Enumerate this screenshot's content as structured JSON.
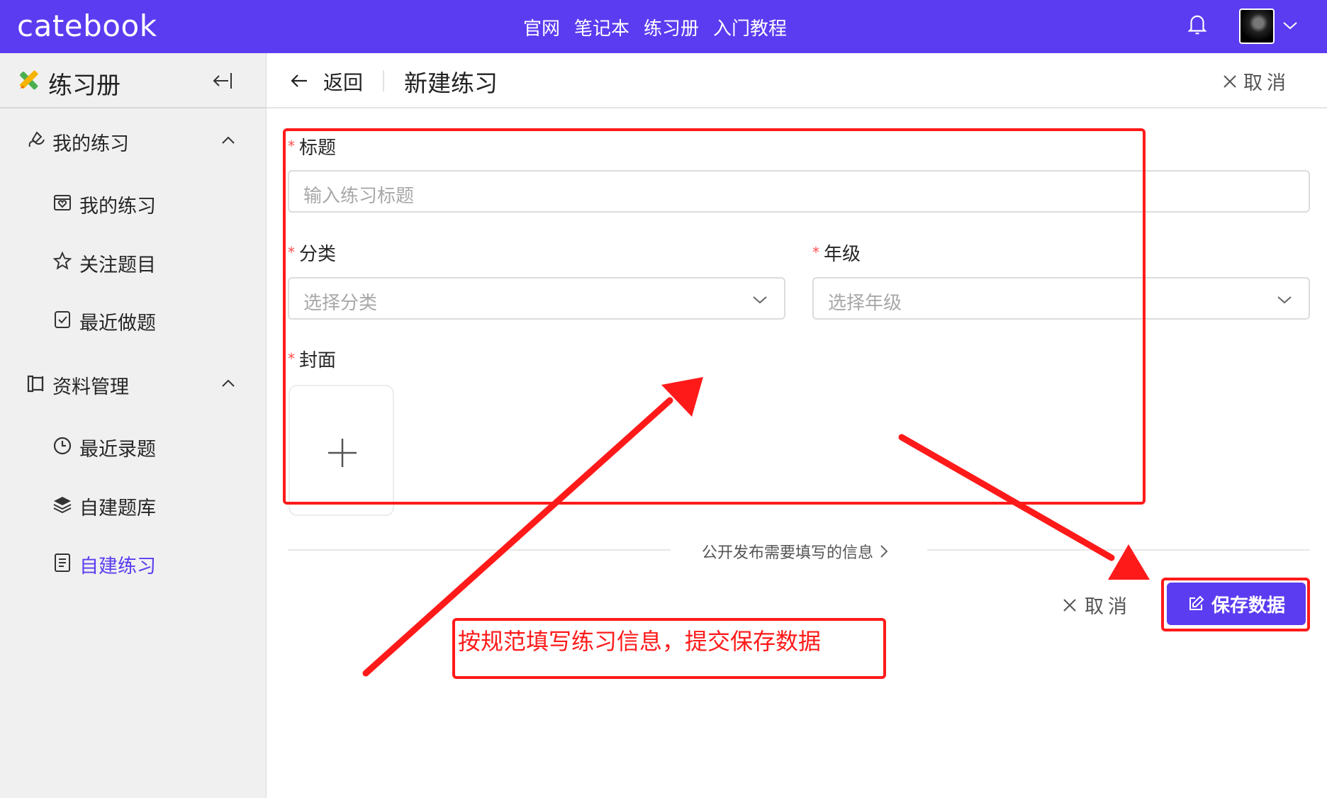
{
  "topbar": {
    "logo": "catebook",
    "nav": [
      "官网",
      "笔记本",
      "练习册",
      "入门教程"
    ]
  },
  "sidebar": {
    "title": "练习册",
    "groups": [
      {
        "label": "我的练习",
        "items": [
          "我的练习",
          "关注题目",
          "最近做题"
        ]
      },
      {
        "label": "资料管理",
        "items": [
          "最近录题",
          "自建题库",
          "自建练习"
        ]
      }
    ],
    "active_item": "自建练习"
  },
  "header": {
    "back_label": "返回",
    "page_title": "新建练习",
    "cancel_label": "取消"
  },
  "form": {
    "required_mark": "*",
    "title_label": "标题",
    "title_placeholder": "输入练习标题",
    "category_label": "分类",
    "category_placeholder": "选择分类",
    "grade_label": "年级",
    "grade_placeholder": "选择年级",
    "cover_label": "封面",
    "publish_info": "公开发布需要填写的信息",
    "cancel_label": "取消",
    "save_label": "保存数据"
  },
  "annotation": {
    "text": "按规范填写练习信息，提交保存数据"
  },
  "colors": {
    "brand": "#5b3cf0",
    "annotation": "#ff1a1a",
    "required": "#ff4d4f"
  }
}
